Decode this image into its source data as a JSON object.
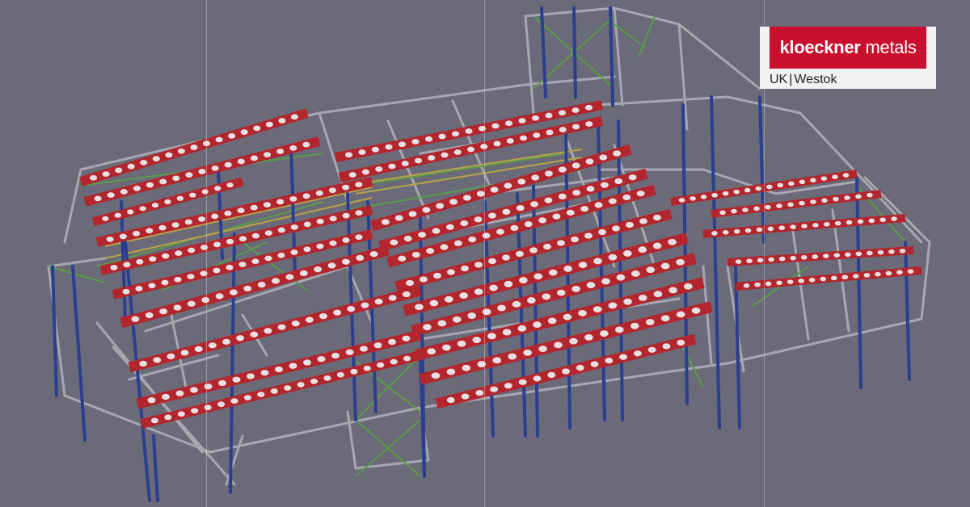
{
  "image": {
    "subject": "3D steel frame structural model",
    "background_color": "#6b6a78",
    "colors": {
      "cellular_beam": "#b3262d",
      "beam_hole": "#e6e0e2",
      "column": "#2a3f8f",
      "grey_member": "#a7a6b1",
      "bracing": "#5a9c4a",
      "purlin": "#b9a24a",
      "guide_line": "#d2d2dc"
    }
  },
  "logo": {
    "brand_bold": "kloeckner",
    "brand_light": "metals",
    "sub_left": "UK",
    "separator": "|",
    "sub_right": "Westok",
    "brand_color": "#c8102e"
  }
}
